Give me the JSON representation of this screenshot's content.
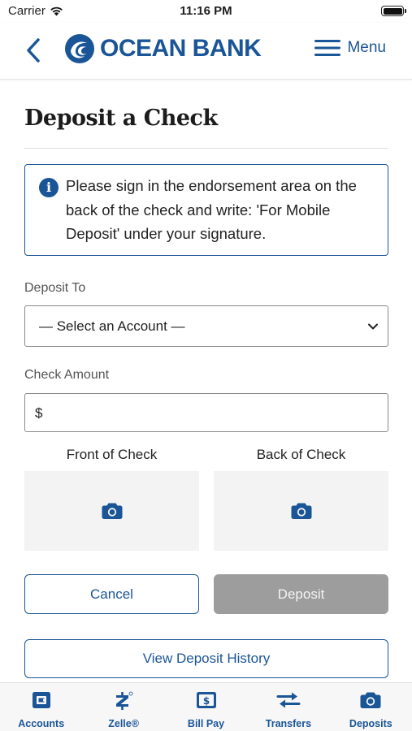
{
  "status_bar": {
    "carrier": "Carrier",
    "time": "11:16 PM"
  },
  "header": {
    "logo_text": "OCEAN BANK",
    "menu_label": "Menu"
  },
  "page": {
    "title": "Deposit a Check",
    "notice": "Please sign in the endorsement area on the back of the check and write: 'For Mobile Deposit' under your signature."
  },
  "form": {
    "deposit_to_label": "Deposit To",
    "deposit_to_value": "— Select an Account —",
    "amount_label": "Check Amount",
    "amount_prefix": "$",
    "amount_value": "",
    "front_label": "Front of Check",
    "back_label": "Back of Check"
  },
  "actions": {
    "cancel_label": "Cancel",
    "deposit_label": "Deposit",
    "history_label": "View Deposit History"
  },
  "tabs": [
    {
      "label": "Accounts",
      "icon": "accounts-icon"
    },
    {
      "label": "Zelle®",
      "icon": "zelle-icon"
    },
    {
      "label": "Bill Pay",
      "icon": "bill-pay-icon"
    },
    {
      "label": "Transfers",
      "icon": "transfers-icon"
    },
    {
      "label": "Deposits",
      "icon": "deposits-icon"
    }
  ],
  "colors": {
    "brand_blue": "#1a5597",
    "disabled_button": "#9d9d9d",
    "upload_slot_bg": "#f3f3f3"
  }
}
